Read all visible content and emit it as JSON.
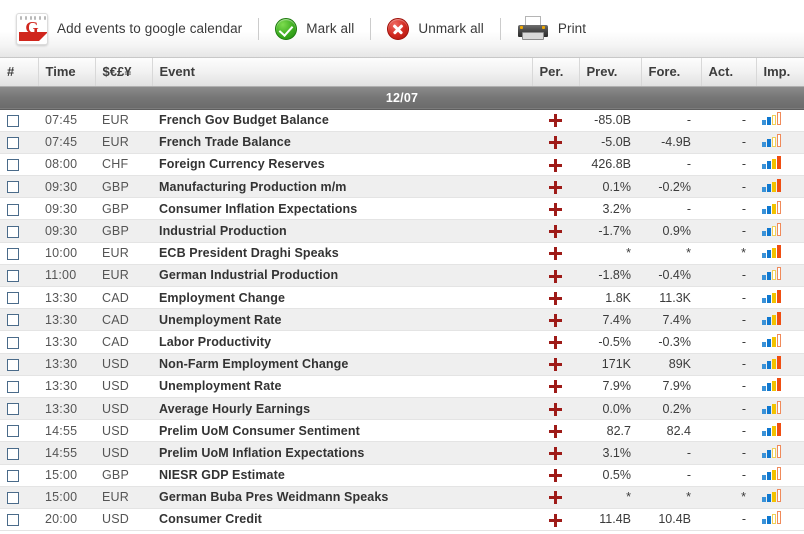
{
  "toolbar": {
    "gcal_label": "Add events to google calendar",
    "gcal_icon_letter": "G",
    "mark_all_label": "Mark all",
    "unmark_all_label": "Unmark all",
    "print_label": "Print"
  },
  "table": {
    "headers": {
      "num": "#",
      "time": "Time",
      "currency": "$€£¥",
      "event": "Event",
      "per": "Per.",
      "prev": "Prev.",
      "fore": "Fore.",
      "act": "Act.",
      "imp": "Imp."
    },
    "date_group": "12/07",
    "rows": [
      {
        "time": "07:45",
        "currency": "EUR",
        "event": "French Gov Budget Balance",
        "prev": "-85.0B",
        "fore": "-",
        "act": "-",
        "importance": 2
      },
      {
        "time": "07:45",
        "currency": "EUR",
        "event": "French Trade Balance",
        "prev": "-5.0B",
        "fore": "-4.9B",
        "act": "-",
        "importance": 2
      },
      {
        "time": "08:00",
        "currency": "CHF",
        "event": "Foreign Currency Reserves",
        "prev": "426.8B",
        "fore": "-",
        "act": "-",
        "importance": 4
      },
      {
        "time": "09:30",
        "currency": "GBP",
        "event": "Manufacturing Production m/m",
        "prev": "0.1%",
        "fore": "-0.2%",
        "act": "-",
        "importance": 4
      },
      {
        "time": "09:30",
        "currency": "GBP",
        "event": "Consumer Inflation Expectations",
        "prev": "3.2%",
        "fore": "-",
        "act": "-",
        "importance": 3
      },
      {
        "time": "09:30",
        "currency": "GBP",
        "event": "Industrial Production",
        "prev": "-1.7%",
        "fore": "0.9%",
        "act": "-",
        "importance": 2
      },
      {
        "time": "10:00",
        "currency": "EUR",
        "event": "ECB President Draghi Speaks",
        "prev": "*",
        "fore": "*",
        "act": "*",
        "importance": 4
      },
      {
        "time": "11:00",
        "currency": "EUR",
        "event": "German Industrial Production",
        "prev": "-1.8%",
        "fore": "-0.4%",
        "act": "-",
        "importance": 2
      },
      {
        "time": "13:30",
        "currency": "CAD",
        "event": "Employment Change",
        "prev": "1.8K",
        "fore": "11.3K",
        "act": "-",
        "importance": 4
      },
      {
        "time": "13:30",
        "currency": "CAD",
        "event": "Unemployment Rate",
        "prev": "7.4%",
        "fore": "7.4%",
        "act": "-",
        "importance": 4
      },
      {
        "time": "13:30",
        "currency": "CAD",
        "event": "Labor Productivity",
        "prev": "-0.5%",
        "fore": "-0.3%",
        "act": "-",
        "importance": 3
      },
      {
        "time": "13:30",
        "currency": "USD",
        "event": "Non-Farm Employment Change",
        "prev": "171K",
        "fore": "89K",
        "act": "-",
        "importance": 4
      },
      {
        "time": "13:30",
        "currency": "USD",
        "event": "Unemployment Rate",
        "prev": "7.9%",
        "fore": "7.9%",
        "act": "-",
        "importance": 4
      },
      {
        "time": "13:30",
        "currency": "USD",
        "event": "Average Hourly Earnings",
        "prev": "0.0%",
        "fore": "0.2%",
        "act": "-",
        "importance": 3
      },
      {
        "time": "14:55",
        "currency": "USD",
        "event": "Prelim UoM Consumer Sentiment",
        "prev": "82.7",
        "fore": "82.4",
        "act": "-",
        "importance": 4
      },
      {
        "time": "14:55",
        "currency": "USD",
        "event": "Prelim UoM Inflation Expectations",
        "prev": "3.1%",
        "fore": "-",
        "act": "-",
        "importance": 2
      },
      {
        "time": "15:00",
        "currency": "GBP",
        "event": "NIESR GDP Estimate",
        "prev": "0.5%",
        "fore": "-",
        "act": "-",
        "importance": 3
      },
      {
        "time": "15:00",
        "currency": "EUR",
        "event": "German Buba Pres Weidmann Speaks",
        "prev": "*",
        "fore": "*",
        "act": "*",
        "importance": 3
      },
      {
        "time": "20:00",
        "currency": "USD",
        "event": "Consumer Credit",
        "prev": "11.4B",
        "fore": "10.4B",
        "act": "-",
        "importance": 2
      }
    ]
  },
  "colors": {
    "accent_red": "#9e1b18",
    "header_gray": "#6b6b6b",
    "imp_low": "#3a92d8",
    "imp_mid": "#f2c200",
    "imp_high": "#f04e11"
  }
}
